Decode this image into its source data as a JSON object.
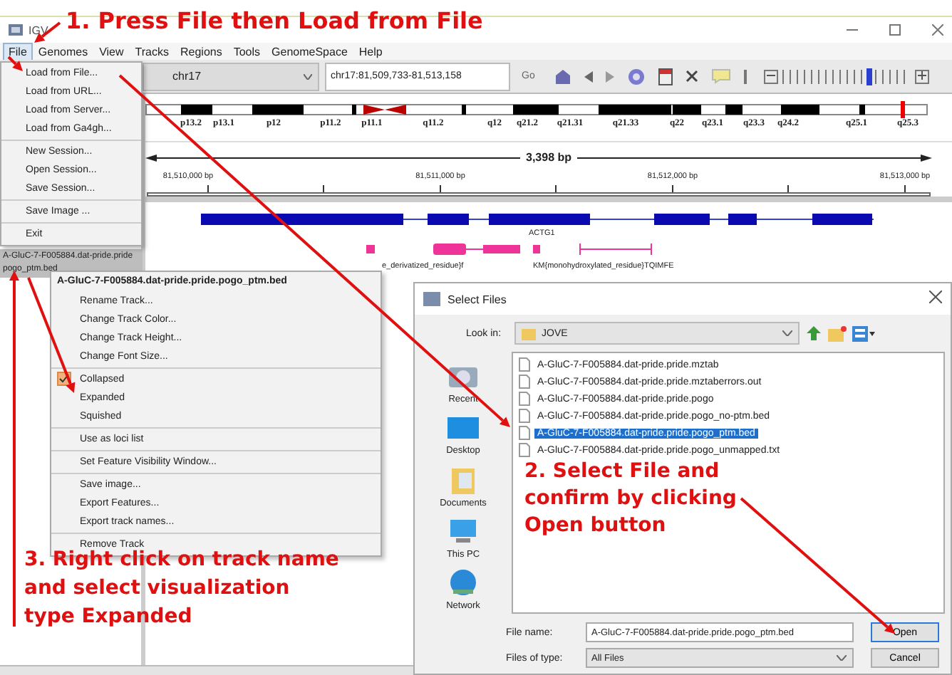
{
  "annotations": [
    {
      "lines": [
        "1. Press File then Load from File"
      ]
    },
    {
      "lines": [
        "2. Select File and",
        "confirm by clicking",
        "Open button"
      ]
    },
    {
      "lines": [
        "3. Right click on track name",
        "and select visualization",
        "type Expanded"
      ]
    }
  ],
  "window": {
    "title": "IGV"
  },
  "menu_bar": [
    {
      "label": "File",
      "selected": true
    },
    {
      "label": "Genomes",
      "selected": false
    },
    {
      "label": "View",
      "selected": false
    },
    {
      "label": "Tracks",
      "selected": false
    },
    {
      "label": "Regions",
      "selected": false
    },
    {
      "label": "Tools",
      "selected": false
    },
    {
      "label": "GenomeSpace",
      "selected": false
    },
    {
      "label": "Help",
      "selected": false
    }
  ],
  "toolbar": {
    "chromosome": "chr17",
    "locus": "chr17:81,509,733-81,513,158",
    "go": "Go",
    "zoom": {
      "level": 0.68
    }
  },
  "ideogram": {
    "bands": [
      "p13.2",
      "p13.1",
      "p12",
      "p11.2",
      "p11.1",
      "q11.2",
      "q12",
      "q21.2",
      "q21.31",
      "q21.33",
      "q22",
      "q23.1",
      "q23.3",
      "q24.2",
      "q25.1",
      "q25.3"
    ]
  },
  "ruler": {
    "span": "3,398 bp",
    "ticks": [
      "81,510,000 bp",
      "81,511,000 bp",
      "81,512,000 bp",
      "81,513,000 bp"
    ]
  },
  "track": {
    "name_lines": [
      "A-GluC-7-F005884.dat-pride.pride",
      "pogo_ptm.bed"
    ],
    "selected": true,
    "gene_label": "ACTG1",
    "feature_labels": [
      "e_derivatized_residue}f",
      "KM{monohydroxylated_residue}TQIMFE"
    ]
  },
  "file_menu": [
    [
      "Load from File...",
      "Load from URL...",
      "Load from Server...",
      "Load from Ga4gh..."
    ],
    [
      "New Session...",
      "Open Session...",
      "Save Session..."
    ],
    [
      "Save Image ..."
    ],
    [
      "Exit"
    ]
  ],
  "context_menu": {
    "title": "A-GluC-7-F005884.dat-pride.pride.pogo_ptm.bed",
    "groups": [
      [
        {
          "label": "Rename Track..."
        },
        {
          "label": "Change Track Color..."
        },
        {
          "label": "Change Track Height..."
        },
        {
          "label": "Change Font Size..."
        }
      ],
      [
        {
          "label": "Collapsed",
          "checked": true
        },
        {
          "label": "Expanded",
          "checked": false
        },
        {
          "label": "Squished",
          "checked": false
        }
      ],
      [
        {
          "label": "Use as loci list"
        }
      ],
      [
        {
          "label": "Set Feature Visibility Window..."
        }
      ],
      [
        {
          "label": "Save image..."
        },
        {
          "label": "Export Features..."
        },
        {
          "label": "Export track names..."
        }
      ],
      [
        {
          "label": "Remove Track"
        }
      ]
    ]
  },
  "dialog": {
    "title": "Select Files",
    "look_in_label": "Look in:",
    "look_in": "JOVE",
    "places": [
      {
        "label": "Recent",
        "kind": "recent"
      },
      {
        "label": "Desktop",
        "kind": "desktop"
      },
      {
        "label": "Documents",
        "kind": "documents"
      },
      {
        "label": "This PC",
        "kind": "pc"
      },
      {
        "label": "Network",
        "kind": "network"
      }
    ],
    "files": [
      {
        "name": "A-GluC-7-F005884.dat-pride.pride.mztab",
        "selected": false
      },
      {
        "name": "A-GluC-7-F005884.dat-pride.pride.mztaberrors.out",
        "selected": false
      },
      {
        "name": "A-GluC-7-F005884.dat-pride.pride.pogo",
        "selected": false
      },
      {
        "name": "A-GluC-7-F005884.dat-pride.pride.pogo_no-ptm.bed",
        "selected": false
      },
      {
        "name": "A-GluC-7-F005884.dat-pride.pride.pogo_ptm.bed",
        "selected": true
      },
      {
        "name": "A-GluC-7-F005884.dat-pride.pride.pogo_unmapped.txt",
        "selected": false
      }
    ],
    "file_name_label": "File name:",
    "file_name": "A-GluC-7-F005884.dat-pride.pride.pogo_ptm.bed",
    "file_type_label": "Files of type:",
    "file_type": "All Files",
    "buttons": [
      {
        "label": "Open",
        "kind": "primary"
      },
      {
        "label": "Cancel",
        "kind": "normal"
      }
    ]
  }
}
